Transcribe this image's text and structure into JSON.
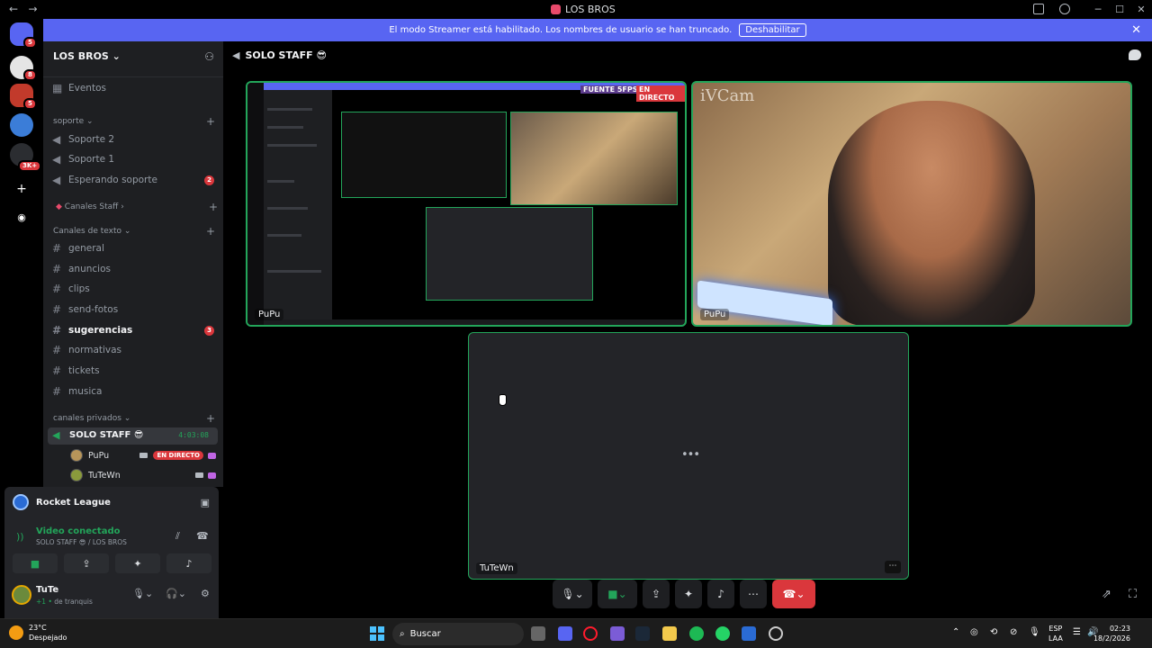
{
  "window": {
    "title": "LOS BROS",
    "nav_back": "←",
    "nav_forward": "→",
    "min": "─",
    "max": "☐",
    "close": "✕"
  },
  "rail": {
    "badges": [
      "5",
      "8",
      "5",
      "3K+"
    ]
  },
  "banner": {
    "text": "El modo Streamer está habilitado. Los nombres de usuario se han truncado.",
    "button": "Deshabilitar",
    "close": "✕"
  },
  "guild": {
    "name": "LOS BROS ⌄",
    "invite_icon": "person-add-icon"
  },
  "channels": {
    "events": "Eventos",
    "cat_soporte": "soporte ⌄",
    "soporte2": "Soporte 2",
    "soporte1": "Soporte 1",
    "esperando": "Esperando soporte",
    "esperando_count": "2",
    "canales_staff": "Canales Staff",
    "cat_texto": "Canales de texto ⌄",
    "text": [
      {
        "name": "general",
        "bright": false
      },
      {
        "name": "anuncios",
        "bright": false
      },
      {
        "name": "clips",
        "bright": false
      },
      {
        "name": "send-fotos",
        "bright": false
      },
      {
        "name": "sugerencias",
        "bright": true,
        "count": "3"
      },
      {
        "name": "normativas",
        "bright": false
      },
      {
        "name": "tickets",
        "bright": false
      },
      {
        "name": "musica",
        "bright": false
      }
    ],
    "cat_privados": "canales privados ⌄",
    "active_voice": "SOLO STAFF 😎",
    "timer": "4:03:08",
    "voice_users": [
      {
        "name": "PuPu",
        "live": "EN DIRECTO"
      },
      {
        "name": "TuTeWn",
        "live": ""
      }
    ]
  },
  "panel": {
    "activity": "Rocket League",
    "status": "Video conectado",
    "status_sub": "SOLO STAFF 😎 / LOS BROS",
    "user_name": "TuTe",
    "user_status": "de tranquis",
    "user_extra": "+1 •"
  },
  "main": {
    "channel_title": "SOLO STAFF 😎",
    "tile1_label": "PuPu",
    "tile2_label": "PuPu",
    "tile2_overlay": "iVCam",
    "tile3_label": "TuTeWn",
    "tile3_dots": "•••",
    "tile3_more": "⋯",
    "mini_fuente": "FUENTE 5FPS",
    "mini_directo": "EN DIRECTO"
  },
  "controls": {
    "mic": "🎙",
    "cam": "■",
    "share": "⇪",
    "activity": "✦",
    "soundboard": "♪",
    "more": "⋯",
    "hangup": "☎"
  },
  "taskbar": {
    "temp": "23°C",
    "weather": "Despejado",
    "search": "Buscar",
    "lang1": "ESP",
    "lang2": "LAA",
    "time": "02:23",
    "date": "18/2/2026"
  }
}
